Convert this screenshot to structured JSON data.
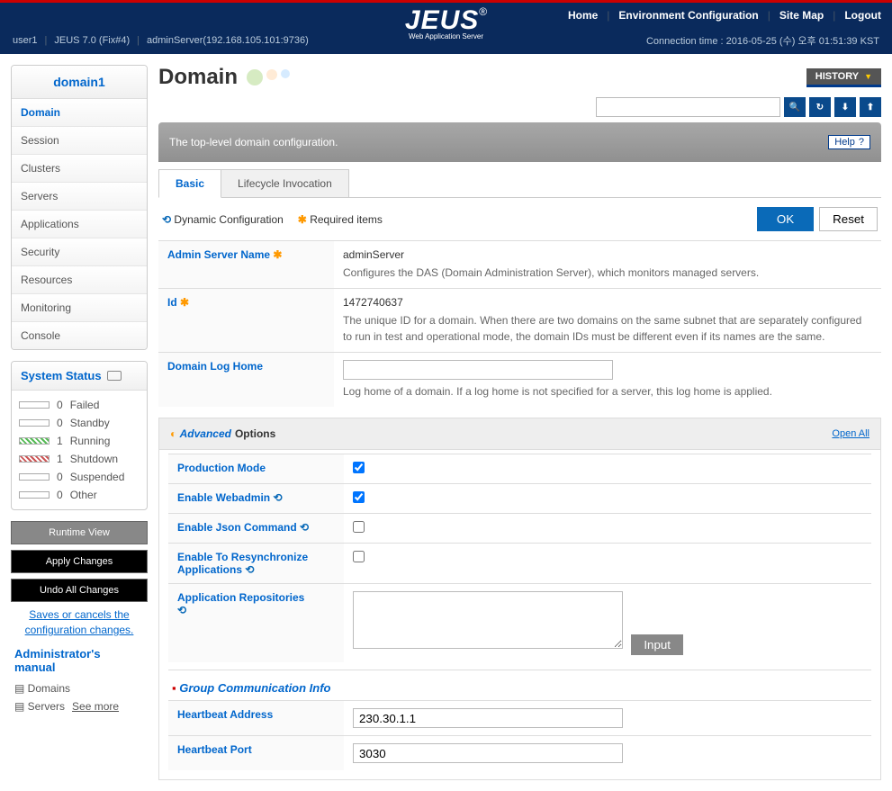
{
  "topnav": {
    "home": "Home",
    "env": "Environment Configuration",
    "sitemap": "Site Map",
    "logout": "Logout"
  },
  "logo": {
    "name": "JEUS",
    "sub": "Web Application Server"
  },
  "session": {
    "user": "user1",
    "version": "JEUS 7.0 (Fix#4)",
    "server": "adminServer(192.168.105.101:9736)",
    "conn": "Connection time : 2016-05-25 (수) 오후 01:51:39 KST"
  },
  "sidebar": {
    "title": "domain1",
    "items": [
      "Domain",
      "Session",
      "Clusters",
      "Servers",
      "Applications",
      "Security",
      "Resources",
      "Monitoring",
      "Console"
    ],
    "status_title": "System Status",
    "status": [
      {
        "count": 0,
        "label": "Failed",
        "color": "#fff"
      },
      {
        "count": 0,
        "label": "Standby",
        "color": "#fff"
      },
      {
        "count": 1,
        "label": "Running",
        "color": "repeating-linear-gradient(45deg,#5b5,#5b5 2px,#fff 2px,#fff 4px)"
      },
      {
        "count": 1,
        "label": "Shutdown",
        "color": "repeating-linear-gradient(45deg,#c55,#c55 2px,#fff 2px,#fff 4px)"
      },
      {
        "count": 0,
        "label": "Suspended",
        "color": "#fff"
      },
      {
        "count": 0,
        "label": "Other",
        "color": "#fff"
      }
    ],
    "runtime": "Runtime View",
    "apply": "Apply Changes",
    "undo": "Undo All Changes",
    "savemsg": "Saves or cancels the configuration changes.",
    "manual": "Administrator's manual",
    "manual_items": [
      "Domains",
      "Servers"
    ],
    "seemore": "See more"
  },
  "page": {
    "title": "Domain",
    "history": "HISTORY",
    "desc": "The top-level domain configuration.",
    "help": "Help",
    "tabs": [
      "Basic",
      "Lifecycle Invocation"
    ],
    "dyn": "Dynamic Configuration",
    "req": "Required items",
    "ok": "OK",
    "reset": "Reset",
    "rows": {
      "admin_label": "Admin Server Name",
      "admin_value": "adminServer",
      "admin_desc": "Configures the DAS (Domain Administration Server), which monitors managed servers.",
      "id_label": "Id",
      "id_value": "1472740637",
      "id_desc": "The unique ID for a domain. When there are two domains on the same subnet that are separately configured to run in test and operational mode, the domain IDs must be different even if its names are the same.",
      "loghome_label": "Domain Log Home",
      "loghome_value": "",
      "loghome_desc": "Log home of a domain. If a log home is not specified for a server, this log home is applied."
    },
    "advanced": "Advanced",
    "options": "Options",
    "openall": "Open All",
    "adv_rows": {
      "production": "Production Mode",
      "webadmin": "Enable Webadmin",
      "json": "Enable Json Command",
      "resync": "Enable To Resynchronize Applications",
      "apprepo": "Application Repositories",
      "input": "Input"
    },
    "group": {
      "title": "Group Communication Info",
      "heartbeat_addr_label": "Heartbeat Address",
      "heartbeat_addr_value": "230.30.1.1",
      "heartbeat_port_label": "Heartbeat Port",
      "heartbeat_port_value": "3030"
    }
  }
}
